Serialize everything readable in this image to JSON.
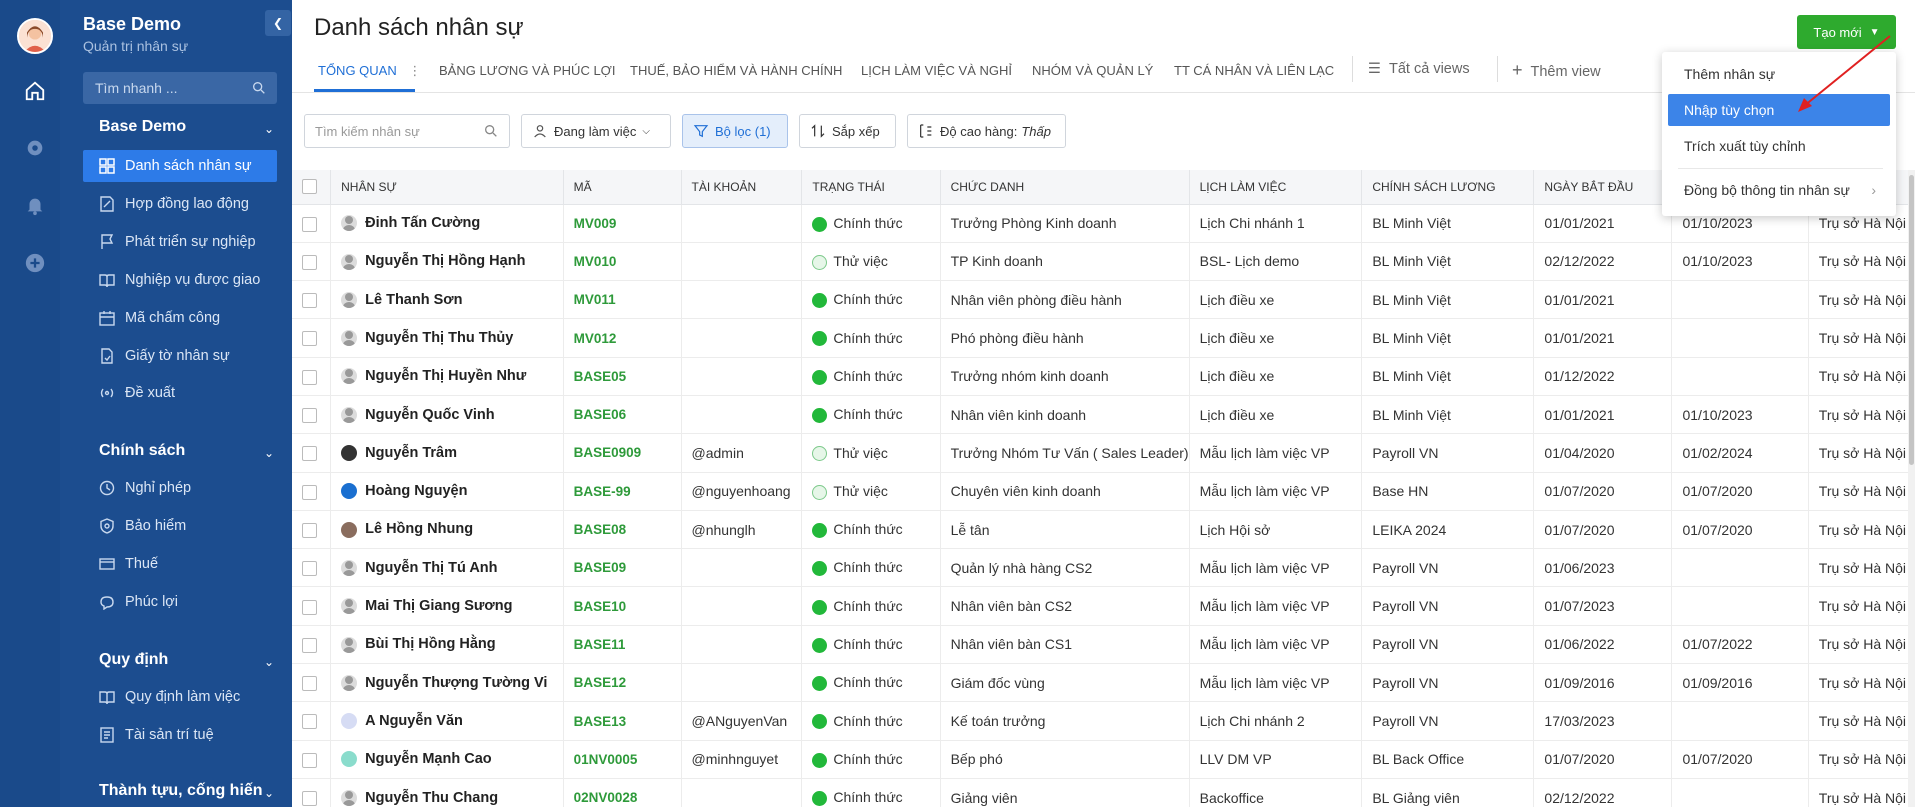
{
  "app": {
    "title": "Base Demo",
    "subtitle": "Quản trị nhân sự"
  },
  "sidebar": {
    "search_placeholder": "Tìm nhanh ...",
    "sections": [
      {
        "title": "Base Demo"
      },
      {
        "title": "Chính sách"
      },
      {
        "title": "Quy định"
      },
      {
        "title": "Thành tựu, cống hiến"
      }
    ],
    "items": [
      {
        "label": "Danh sách nhân sự",
        "icon": "grid-icon",
        "active": true
      },
      {
        "label": "Hợp đồng lao động",
        "icon": "contract-icon"
      },
      {
        "label": "Phát triển sự nghiệp",
        "icon": "flag-icon"
      },
      {
        "label": "Nghiệp vụ được giao",
        "icon": "book-icon"
      },
      {
        "label": "Mã chấm công",
        "icon": "calendar-icon"
      },
      {
        "label": "Giấy tờ nhân sự",
        "icon": "document-icon"
      },
      {
        "label": "Đề xuất",
        "icon": "broadcast-icon"
      },
      {
        "label": "Nghỉ phép",
        "icon": "clock-icon"
      },
      {
        "label": "Bảo hiểm",
        "icon": "shield-icon"
      },
      {
        "label": "Thuế",
        "icon": "card-icon"
      },
      {
        "label": "Phúc lợi",
        "icon": "gift-icon"
      },
      {
        "label": "Quy định làm việc",
        "icon": "book-icon"
      },
      {
        "label": "Tài sản trí tuệ",
        "icon": "asset-icon"
      }
    ]
  },
  "header": {
    "page_title": "Danh sách nhân sự",
    "create_button": "Tạo mới"
  },
  "tabs": [
    "TỔNG QUAN",
    "BẢNG LƯƠNG VÀ PHÚC LỢI",
    "THUẾ, BẢO HIỂM VÀ HÀNH CHÍNH",
    "LỊCH LÀM VIỆC VÀ NGHỈ",
    "NHÓM VÀ QUẢN LÝ",
    "TT CÁ NHÂN VÀ LIÊN LẠC"
  ],
  "views": {
    "all_views": "Tất cả views",
    "add_view": "Thêm view"
  },
  "toolbar": {
    "search_placeholder": "Tìm kiếm nhân sự",
    "status_filter": "Đang làm việc",
    "filter": "Bộ lọc (1)",
    "sort": "Sắp xếp",
    "row_height_label": "Độ cao hàng:",
    "row_height_value": "Thấp"
  },
  "dropdown": {
    "items": [
      "Thêm nhân sự",
      "Nhập tùy chọn",
      "Trích xuất tùy chỉnh",
      "Đồng bộ thông tin nhân sự"
    ],
    "highlighted_index": 1
  },
  "table": {
    "columns": [
      "NHÂN SỰ",
      "MÃ",
      "TÀI KHOẢN",
      "TRẠNG THÁI",
      "CHỨC DANH",
      "LỊCH LÀM VIỆC",
      "CHÍNH SÁCH LƯƠNG",
      "NGÀY BẮT ĐẦU",
      "",
      ""
    ],
    "rows": [
      {
        "name": "Đinh Tấn Cường",
        "code": "MV009",
        "account": "",
        "status": "Chính thức",
        "status_type": "solid",
        "title": "Trưởng Phòng Kinh doanh",
        "schedule": "Lịch Chi nhánh 1",
        "policy": "BL Minh Việt",
        "start": "01/01/2021",
        "date2": "01/10/2023",
        "office": "Trụ sở Hà Nội",
        "avatar": "gray"
      },
      {
        "name": "Nguyễn Thị Hồng Hạnh",
        "code": "MV010",
        "account": "",
        "status": "Thử việc",
        "status_type": "hollow",
        "title": "TP Kinh doanh",
        "schedule": "BSL- Lịch demo",
        "policy": "BL Minh Việt",
        "start": "02/12/2022",
        "date2": "01/10/2023",
        "office": "Trụ sở Hà Nội",
        "avatar": "gray"
      },
      {
        "name": "Lê Thanh Sơn",
        "code": "MV011",
        "account": "",
        "status": "Chính thức",
        "status_type": "solid",
        "title": "Nhân viên phòng điều hành",
        "schedule": "Lịch điều xe",
        "policy": "BL Minh Việt",
        "start": "01/01/2021",
        "date2": "",
        "office": "Trụ sở Hà Nội",
        "avatar": "gray"
      },
      {
        "name": "Nguyễn Thị Thu Thủy",
        "code": "MV012",
        "account": "",
        "status": "Chính thức",
        "status_type": "solid",
        "title": "Phó phòng điều hành",
        "schedule": "Lịch điều xe",
        "policy": "BL Minh Việt",
        "start": "01/01/2021",
        "date2": "",
        "office": "Trụ sở Hà Nội",
        "avatar": "gray"
      },
      {
        "name": "Nguyễn Thị Huyền Như",
        "code": "BASE05",
        "account": "",
        "status": "Chính thức",
        "status_type": "solid",
        "title": "Trưởng nhóm kinh doanh",
        "schedule": "Lịch điều xe",
        "policy": "BL Minh Việt",
        "start": "01/12/2022",
        "date2": "",
        "office": "Trụ sở Hà Nội",
        "avatar": "gray"
      },
      {
        "name": "Nguyễn Quốc Vinh",
        "code": "BASE06",
        "account": "",
        "status": "Chính thức",
        "status_type": "solid",
        "title": "Nhân viên kinh doanh",
        "schedule": "Lịch điều xe",
        "policy": "BL Minh Việt",
        "start": "01/01/2021",
        "date2": "01/10/2023",
        "office": "Trụ sở Hà Nội",
        "avatar": "gray"
      },
      {
        "name": "Nguyễn Trâm",
        "code": "BASE0909",
        "account": "@admin",
        "status": "Thử việc",
        "status_type": "hollow",
        "title": "Trưởng Nhóm Tư Vấn ( Sales Leader)",
        "schedule": "Mẫu lịch làm việc VP",
        "policy": "Payroll VN",
        "start": "01/04/2020",
        "date2": "01/02/2024",
        "office": "Trụ sở Hà Nội",
        "avatar": "dark"
      },
      {
        "name": "Hoàng Nguyện",
        "code": "BASE-99",
        "account": "@nguyenhoang",
        "status": "Thử việc",
        "status_type": "hollow",
        "title": "Chuyên viên kinh doanh",
        "schedule": "Mẫu lịch làm việc VP",
        "policy": "Base HN",
        "start": "01/07/2020",
        "date2": "01/07/2020",
        "office": "Trụ sở Hà Nội",
        "avatar": "blue"
      },
      {
        "name": "Lê Hồng Nhung",
        "code": "BASE08",
        "account": "@nhunglh",
        "status": "Chính thức",
        "status_type": "solid",
        "title": "Lễ tân",
        "schedule": "Lịch Hội sở",
        "policy": "LEIKA 2024",
        "start": "01/07/2020",
        "date2": "01/07/2020",
        "office": "Trụ sở Hà Nội",
        "avatar": "photo"
      },
      {
        "name": "Nguyễn Thị Tú Anh",
        "code": "BASE09",
        "account": "",
        "status": "Chính thức",
        "status_type": "solid",
        "title": "Quản lý nhà hàng CS2",
        "schedule": "Mẫu lịch làm việc VP",
        "policy": "Payroll VN",
        "start": "01/06/2023",
        "date2": "",
        "office": "Trụ sở Hà Nội",
        "avatar": "gray"
      },
      {
        "name": "Mai Thị Giang Sương",
        "code": "BASE10",
        "account": "",
        "status": "Chính thức",
        "status_type": "solid",
        "title": "Nhân viên bàn CS2",
        "schedule": "Mẫu lịch làm việc VP",
        "policy": "Payroll VN",
        "start": "01/07/2023",
        "date2": "",
        "office": "Trụ sở Hà Nội",
        "avatar": "gray"
      },
      {
        "name": "Bùi Thị Hồng Hằng",
        "code": "BASE11",
        "account": "",
        "status": "Chính thức",
        "status_type": "solid",
        "title": "Nhân viên bàn CS1",
        "schedule": "Mẫu lịch làm việc VP",
        "policy": "Payroll VN",
        "start": "01/06/2022",
        "date2": "01/07/2022",
        "office": "Trụ sở Hà Nội",
        "avatar": "gray"
      },
      {
        "name": "Nguyễn Thượng Tường Vi",
        "code": "BASE12",
        "account": "",
        "status": "Chính thức",
        "status_type": "solid",
        "title": "Giám đốc vùng",
        "schedule": "Mẫu lịch làm việc VP",
        "policy": "Payroll VN",
        "start": "01/09/2016",
        "date2": "01/09/2016",
        "office": "Trụ sở Hà Nội",
        "avatar": "gray"
      },
      {
        "name": "A Nguyễn Văn",
        "code": "BASE13",
        "account": "@ANguyenVan",
        "status": "Chính thức",
        "status_type": "solid",
        "title": "Kế toán trưởng",
        "schedule": "Lịch Chi nhánh 2",
        "policy": "Payroll VN",
        "start": "17/03/2023",
        "date2": "",
        "office": "Trụ sở Hà Nội",
        "avatar": "light"
      },
      {
        "name": "Nguyễn Mạnh Cao",
        "code": "01NV0005",
        "account": "@minhnguyet",
        "status": "Chính thức",
        "status_type": "solid",
        "title": "Bếp phó",
        "schedule": "LLV DM VP",
        "policy": "BL Back Office",
        "start": "01/07/2020",
        "date2": "01/07/2020",
        "office": "Trụ sở Hà Nội",
        "avatar": "teal"
      },
      {
        "name": "Nguyễn Thu Chang",
        "code": "02NV0028",
        "account": "",
        "status": "Chính thức",
        "status_type": "solid",
        "title": "Giảng viên",
        "schedule": "Backoffice",
        "policy": "BL Giảng viên",
        "start": "02/12/2022",
        "date2": "",
        "office": "Trụ sở Hà Nội",
        "avatar": "gray"
      }
    ]
  }
}
